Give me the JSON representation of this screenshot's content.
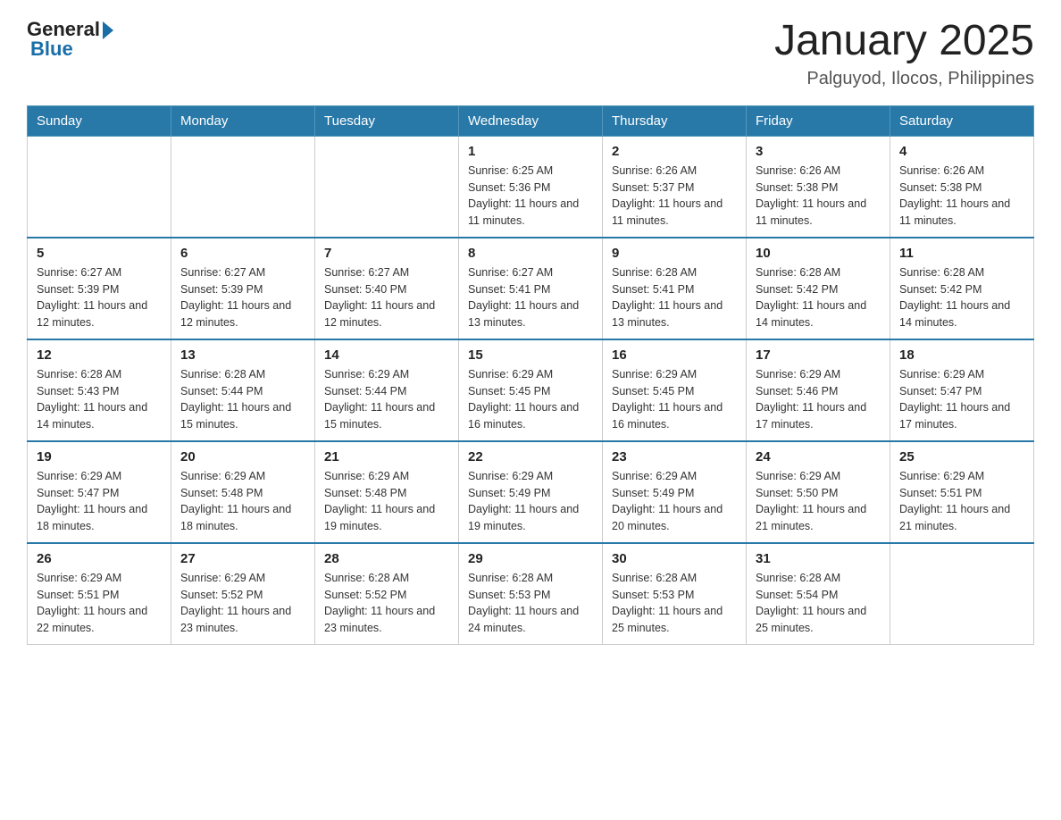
{
  "logo": {
    "general": "General",
    "blue": "Blue"
  },
  "title": {
    "month_year": "January 2025",
    "location": "Palguyod, Ilocos, Philippines"
  },
  "headers": [
    "Sunday",
    "Monday",
    "Tuesday",
    "Wednesday",
    "Thursday",
    "Friday",
    "Saturday"
  ],
  "weeks": [
    [
      {
        "day": "",
        "info": ""
      },
      {
        "day": "",
        "info": ""
      },
      {
        "day": "",
        "info": ""
      },
      {
        "day": "1",
        "info": "Sunrise: 6:25 AM\nSunset: 5:36 PM\nDaylight: 11 hours and 11 minutes."
      },
      {
        "day": "2",
        "info": "Sunrise: 6:26 AM\nSunset: 5:37 PM\nDaylight: 11 hours and 11 minutes."
      },
      {
        "day": "3",
        "info": "Sunrise: 6:26 AM\nSunset: 5:38 PM\nDaylight: 11 hours and 11 minutes."
      },
      {
        "day": "4",
        "info": "Sunrise: 6:26 AM\nSunset: 5:38 PM\nDaylight: 11 hours and 11 minutes."
      }
    ],
    [
      {
        "day": "5",
        "info": "Sunrise: 6:27 AM\nSunset: 5:39 PM\nDaylight: 11 hours and 12 minutes."
      },
      {
        "day": "6",
        "info": "Sunrise: 6:27 AM\nSunset: 5:39 PM\nDaylight: 11 hours and 12 minutes."
      },
      {
        "day": "7",
        "info": "Sunrise: 6:27 AM\nSunset: 5:40 PM\nDaylight: 11 hours and 12 minutes."
      },
      {
        "day": "8",
        "info": "Sunrise: 6:27 AM\nSunset: 5:41 PM\nDaylight: 11 hours and 13 minutes."
      },
      {
        "day": "9",
        "info": "Sunrise: 6:28 AM\nSunset: 5:41 PM\nDaylight: 11 hours and 13 minutes."
      },
      {
        "day": "10",
        "info": "Sunrise: 6:28 AM\nSunset: 5:42 PM\nDaylight: 11 hours and 14 minutes."
      },
      {
        "day": "11",
        "info": "Sunrise: 6:28 AM\nSunset: 5:42 PM\nDaylight: 11 hours and 14 minutes."
      }
    ],
    [
      {
        "day": "12",
        "info": "Sunrise: 6:28 AM\nSunset: 5:43 PM\nDaylight: 11 hours and 14 minutes."
      },
      {
        "day": "13",
        "info": "Sunrise: 6:28 AM\nSunset: 5:44 PM\nDaylight: 11 hours and 15 minutes."
      },
      {
        "day": "14",
        "info": "Sunrise: 6:29 AM\nSunset: 5:44 PM\nDaylight: 11 hours and 15 minutes."
      },
      {
        "day": "15",
        "info": "Sunrise: 6:29 AM\nSunset: 5:45 PM\nDaylight: 11 hours and 16 minutes."
      },
      {
        "day": "16",
        "info": "Sunrise: 6:29 AM\nSunset: 5:45 PM\nDaylight: 11 hours and 16 minutes."
      },
      {
        "day": "17",
        "info": "Sunrise: 6:29 AM\nSunset: 5:46 PM\nDaylight: 11 hours and 17 minutes."
      },
      {
        "day": "18",
        "info": "Sunrise: 6:29 AM\nSunset: 5:47 PM\nDaylight: 11 hours and 17 minutes."
      }
    ],
    [
      {
        "day": "19",
        "info": "Sunrise: 6:29 AM\nSunset: 5:47 PM\nDaylight: 11 hours and 18 minutes."
      },
      {
        "day": "20",
        "info": "Sunrise: 6:29 AM\nSunset: 5:48 PM\nDaylight: 11 hours and 18 minutes."
      },
      {
        "day": "21",
        "info": "Sunrise: 6:29 AM\nSunset: 5:48 PM\nDaylight: 11 hours and 19 minutes."
      },
      {
        "day": "22",
        "info": "Sunrise: 6:29 AM\nSunset: 5:49 PM\nDaylight: 11 hours and 19 minutes."
      },
      {
        "day": "23",
        "info": "Sunrise: 6:29 AM\nSunset: 5:49 PM\nDaylight: 11 hours and 20 minutes."
      },
      {
        "day": "24",
        "info": "Sunrise: 6:29 AM\nSunset: 5:50 PM\nDaylight: 11 hours and 21 minutes."
      },
      {
        "day": "25",
        "info": "Sunrise: 6:29 AM\nSunset: 5:51 PM\nDaylight: 11 hours and 21 minutes."
      }
    ],
    [
      {
        "day": "26",
        "info": "Sunrise: 6:29 AM\nSunset: 5:51 PM\nDaylight: 11 hours and 22 minutes."
      },
      {
        "day": "27",
        "info": "Sunrise: 6:29 AM\nSunset: 5:52 PM\nDaylight: 11 hours and 23 minutes."
      },
      {
        "day": "28",
        "info": "Sunrise: 6:28 AM\nSunset: 5:52 PM\nDaylight: 11 hours and 23 minutes."
      },
      {
        "day": "29",
        "info": "Sunrise: 6:28 AM\nSunset: 5:53 PM\nDaylight: 11 hours and 24 minutes."
      },
      {
        "day": "30",
        "info": "Sunrise: 6:28 AM\nSunset: 5:53 PM\nDaylight: 11 hours and 25 minutes."
      },
      {
        "day": "31",
        "info": "Sunrise: 6:28 AM\nSunset: 5:54 PM\nDaylight: 11 hours and 25 minutes."
      },
      {
        "day": "",
        "info": ""
      }
    ]
  ]
}
